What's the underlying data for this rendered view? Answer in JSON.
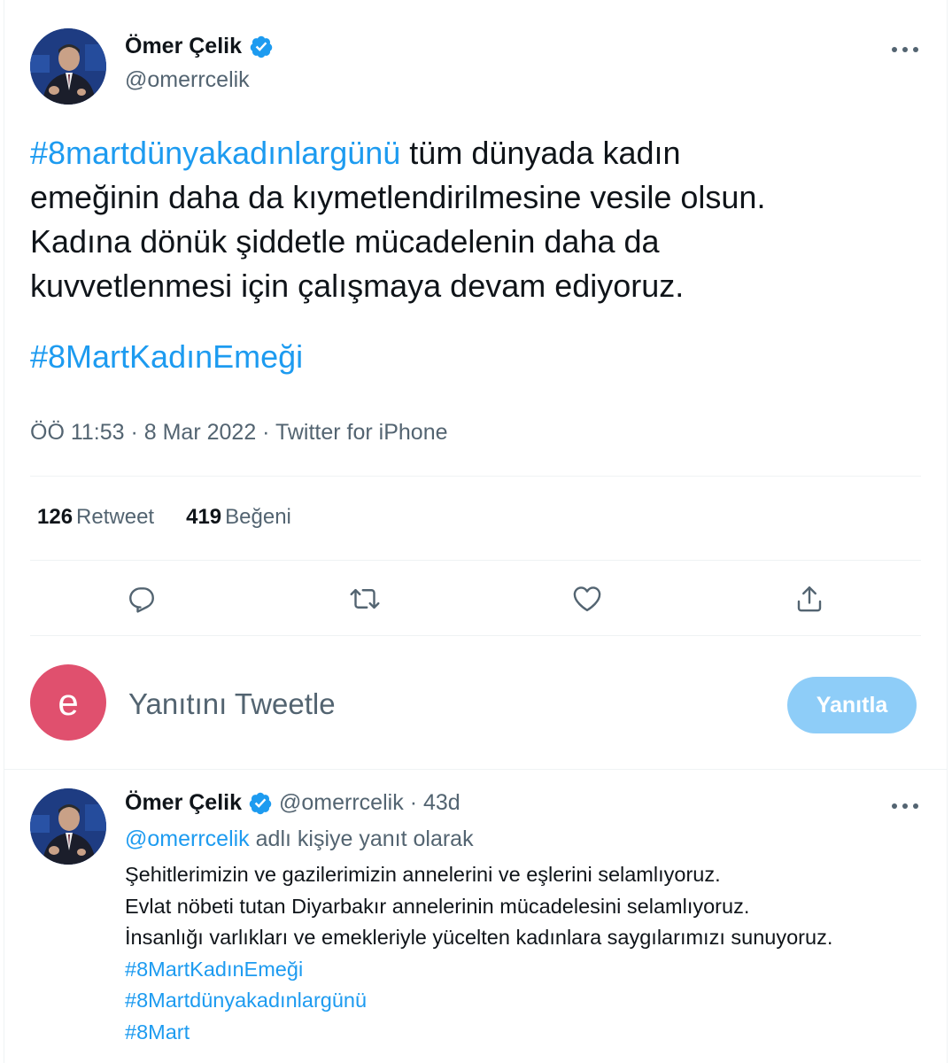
{
  "tweet": {
    "author": {
      "name": "Ömer Çelik",
      "handle": "@omerrcelik"
    },
    "text": {
      "line1_tag": "#8martdünyakadınlargünü",
      "line1_rest": " tüm dünyada kadın",
      "line2": "emeğinin daha da kıymetlendirilmesine vesile olsun.",
      "line3": "Kadına dönük şiddetle mücadelenin daha da",
      "line4": "kuvvetlenmesi için çalışmaya devam ediyoruz.",
      "hashtag": "#8MartKadınEmeği"
    },
    "meta": "ÖÖ 11:53 · 8 Mar 2022 · Twitter for iPhone",
    "stats": {
      "retweets": "126",
      "retweets_label": "Retweet",
      "likes": "419",
      "likes_label": "Beğeni"
    },
    "icons": [
      "reply-icon",
      "retweet-icon",
      "like-icon",
      "share-icon"
    ]
  },
  "composer": {
    "avatar_letter": "e",
    "placeholder": "Yanıtını Tweetle",
    "button": "Yanıtla"
  },
  "reply": {
    "author": {
      "name": "Ömer Çelik",
      "handle": "@omerrcelik",
      "time": "· 43d"
    },
    "replying_tag": "@omerrcelik",
    "replying_rest": " adlı kişiye yanıt olarak",
    "lines": [
      "Şehitlerimizin ve gazilerimizin annelerini ve eşlerini selamlıyoruz.",
      "Evlat nöbeti tutan Diyarbakır annelerinin mücadelesini selamlıyoruz.",
      "İnsanlığı varlıkları ve emekleriyle yücelten kadınlara saygılarımızı sunuyoruz."
    ],
    "hashtags": [
      "#8MartKadınEmeği",
      "#8Martdünyakadınlargünü",
      "#8Mart"
    ]
  },
  "colors": {
    "accent": "#1d9bf0",
    "text": "#0f1419",
    "muted": "#536471",
    "button_disabled": "#8ecdf8",
    "avatar_e": "#e0506e"
  }
}
